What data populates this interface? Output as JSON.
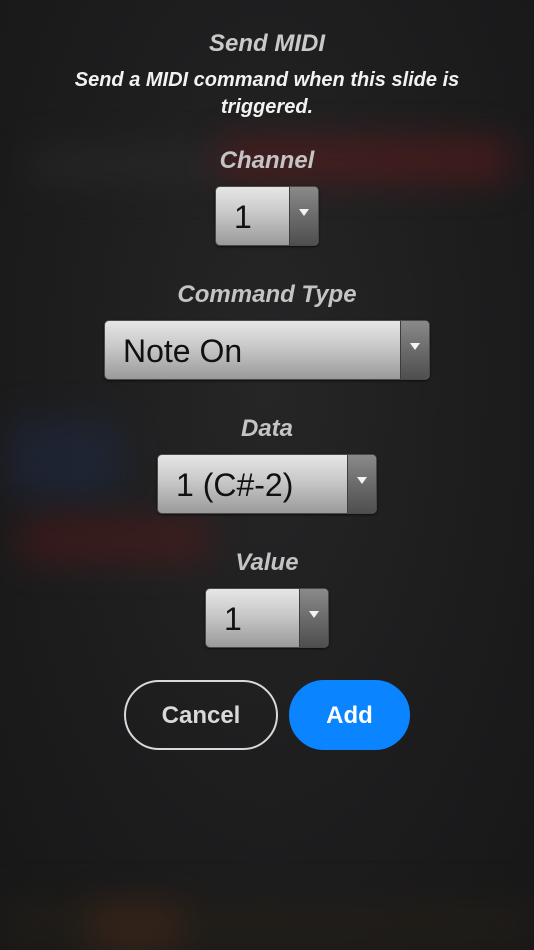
{
  "dialog": {
    "title": "Send MIDI",
    "subtitle": "Send a MIDI command when this slide is triggered."
  },
  "fields": {
    "channel": {
      "label": "Channel",
      "value": "1"
    },
    "command_type": {
      "label": "Command Type",
      "value": "Note On"
    },
    "data": {
      "label": "Data",
      "value": "1 (C#-2)"
    },
    "value": {
      "label": "Value",
      "value": "1"
    }
  },
  "buttons": {
    "cancel_label": "Cancel",
    "add_label": "Add"
  },
  "colors": {
    "accent": "#0a84ff",
    "background": "#1c1c1d"
  },
  "icons": {
    "dropdown": "chevron-down-icon"
  }
}
